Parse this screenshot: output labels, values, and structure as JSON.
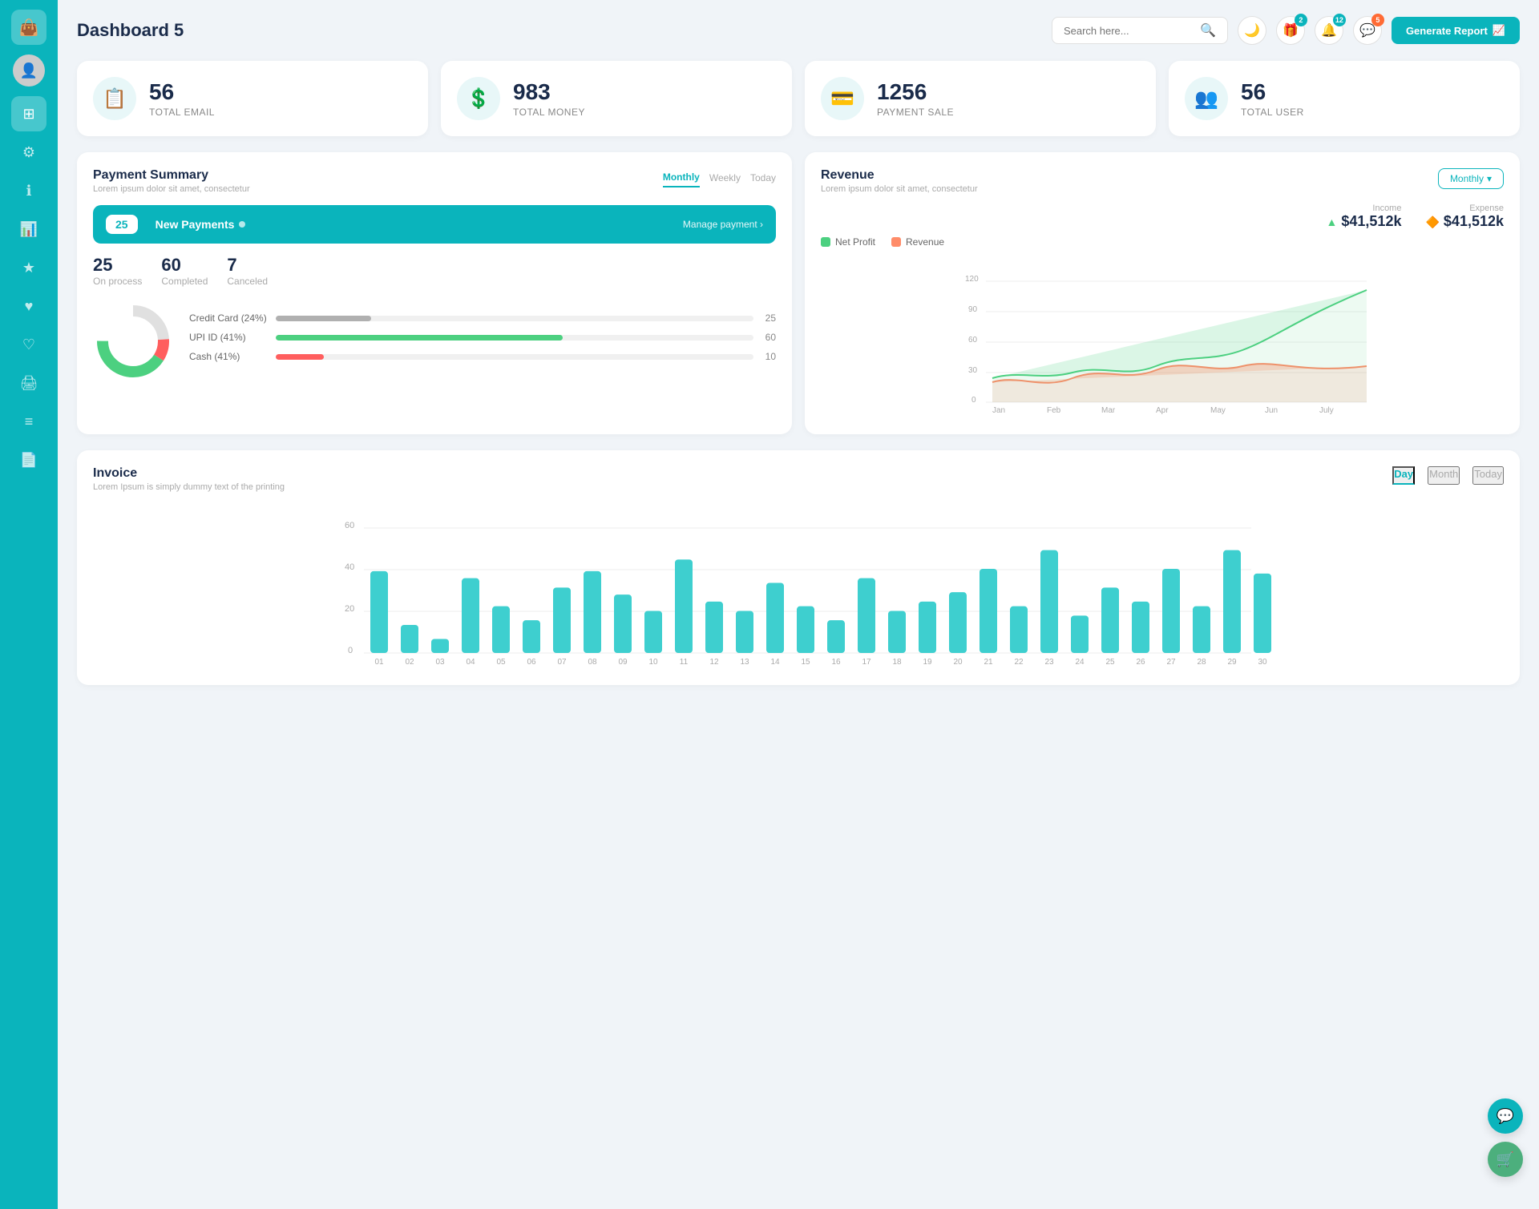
{
  "app": {
    "title": "Dashboard 5"
  },
  "header": {
    "search_placeholder": "Search here...",
    "generate_btn": "Generate Report",
    "icons": {
      "moon": "🌙",
      "gift_badge": "2",
      "bell_badge": "12",
      "chat_badge": "5"
    }
  },
  "stats": [
    {
      "id": "email",
      "number": "56",
      "label": "TOTAL EMAIL",
      "icon": "📋"
    },
    {
      "id": "money",
      "number": "983",
      "label": "TOTAL MONEY",
      "icon": "💲"
    },
    {
      "id": "payment",
      "number": "1256",
      "label": "PAYMENT SALE",
      "icon": "💳"
    },
    {
      "id": "user",
      "number": "56",
      "label": "TOTAL USER",
      "icon": "👥"
    }
  ],
  "payment_summary": {
    "title": "Payment Summary",
    "subtitle": "Lorem ipsum dolor sit amet, consectetur",
    "tabs": [
      "Monthly",
      "Weekly",
      "Today"
    ],
    "active_tab": "Monthly",
    "new_payments_count": "25",
    "new_payments_label": "New Payments",
    "manage_link": "Manage payment",
    "on_process": {
      "number": "25",
      "label": "On process"
    },
    "completed": {
      "number": "60",
      "label": "Completed"
    },
    "canceled": {
      "number": "7",
      "label": "Canceled"
    },
    "progress_items": [
      {
        "label": "Credit Card (24%)",
        "pct": 20,
        "color": "#b0b0b0",
        "value": "25"
      },
      {
        "label": "UPI ID (41%)",
        "pct": 60,
        "color": "#4cd080",
        "value": "60"
      },
      {
        "label": "Cash (41%)",
        "pct": 10,
        "color": "#ff5e5e",
        "value": "10"
      }
    ]
  },
  "revenue": {
    "title": "Revenue",
    "subtitle": "Lorem ipsum dolor sit amet, consectetur",
    "dropdown": "Monthly",
    "income_label": "Income",
    "income_value": "$41,512k",
    "expense_label": "Expense",
    "expense_value": "$41,512k",
    "legend": [
      {
        "label": "Net Profit",
        "color": "#4cd080"
      },
      {
        "label": "Revenue",
        "color": "#ff8c69"
      }
    ],
    "x_labels": [
      "Jan",
      "Feb",
      "Mar",
      "Apr",
      "May",
      "Jun",
      "July"
    ],
    "y_labels": [
      "0",
      "30",
      "60",
      "90",
      "120"
    ]
  },
  "invoice": {
    "title": "Invoice",
    "subtitle": "Lorem Ipsum is simply dummy text of the printing",
    "tabs": [
      "Day",
      "Month",
      "Today"
    ],
    "active_tab": "Day",
    "y_labels": [
      "0",
      "20",
      "40",
      "60"
    ],
    "x_labels": [
      "01",
      "02",
      "03",
      "04",
      "05",
      "06",
      "07",
      "08",
      "09",
      "10",
      "11",
      "12",
      "13",
      "14",
      "15",
      "16",
      "17",
      "18",
      "19",
      "20",
      "21",
      "22",
      "23",
      "24",
      "25",
      "26",
      "27",
      "28",
      "29",
      "30"
    ],
    "bar_values": [
      35,
      12,
      6,
      32,
      20,
      14,
      28,
      35,
      25,
      18,
      40,
      22,
      18,
      30,
      20,
      14,
      32,
      18,
      22,
      26,
      36,
      20,
      44,
      16,
      28,
      22,
      36,
      20,
      44,
      34
    ]
  },
  "sidebar": {
    "items": [
      {
        "id": "wallet",
        "icon": "💼",
        "active": true,
        "label": "wallet"
      },
      {
        "id": "dashboard",
        "icon": "⊞",
        "active": true,
        "label": "dashboard"
      },
      {
        "id": "settings",
        "icon": "⚙",
        "active": false,
        "label": "settings"
      },
      {
        "id": "info",
        "icon": "ℹ",
        "active": false,
        "label": "info"
      },
      {
        "id": "chart",
        "icon": "📊",
        "active": false,
        "label": "chart"
      },
      {
        "id": "star",
        "icon": "★",
        "active": false,
        "label": "star"
      },
      {
        "id": "heart",
        "icon": "♥",
        "active": false,
        "label": "heart"
      },
      {
        "id": "heart2",
        "icon": "♡",
        "active": false,
        "label": "heart2"
      },
      {
        "id": "print",
        "icon": "🖨",
        "active": false,
        "label": "print"
      },
      {
        "id": "menu",
        "icon": "≡",
        "active": false,
        "label": "menu"
      },
      {
        "id": "list",
        "icon": "📄",
        "active": false,
        "label": "list"
      }
    ]
  },
  "floatBtns": [
    {
      "id": "support",
      "icon": "💬",
      "color": "teal"
    },
    {
      "id": "cart",
      "icon": "🛒",
      "color": "green"
    }
  ]
}
